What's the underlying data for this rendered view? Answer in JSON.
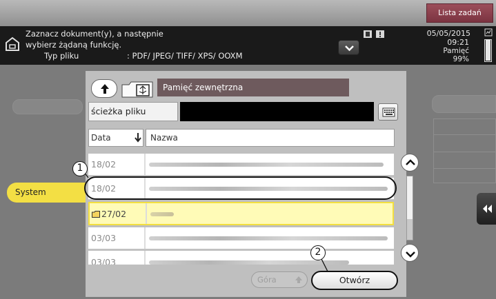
{
  "top_bar": {
    "job_list_button": "Lista zadań"
  },
  "header": {
    "instruction_line1": "Zaznacz dokument(y), a następnie",
    "instruction_line2": "wybierz żądaną funkcję.",
    "file_type_label": "Typ pliku",
    "file_type_value": ": PDF/ JPEG/ TIFF/ XPS/ OOXM",
    "date": "05/05/2015",
    "time": "09:21",
    "memory_label": "Pamięć",
    "memory_percent": "99%",
    "memory_fraction": 0.99
  },
  "browser": {
    "location_title": "Pamięć zewnętrzna",
    "path_label": "ścieżka pliku",
    "path_value": "",
    "sort_date_label": "Data",
    "sort_name_label": "Nazwa",
    "rows": [
      {
        "date": "18/02",
        "is_folder": false,
        "selected": false
      },
      {
        "date": "18/02",
        "is_folder": false,
        "selected": false
      },
      {
        "date": "27/02",
        "is_folder": true,
        "selected": true
      },
      {
        "date": "03/03",
        "is_folder": false,
        "selected": false
      },
      {
        "date": "03/03",
        "is_folder": false,
        "selected": false
      }
    ],
    "up_button_label": "Góra",
    "open_button_label": "Otwórz"
  },
  "left_tabs": {
    "system": "System"
  },
  "callouts": {
    "first": "1",
    "second": "2"
  },
  "colors": {
    "accent_yellow": "#f3df44",
    "selected_row": "#fffbb7",
    "title_bar": "#6e5a5d",
    "job_list_button": "#8a3f4c"
  }
}
